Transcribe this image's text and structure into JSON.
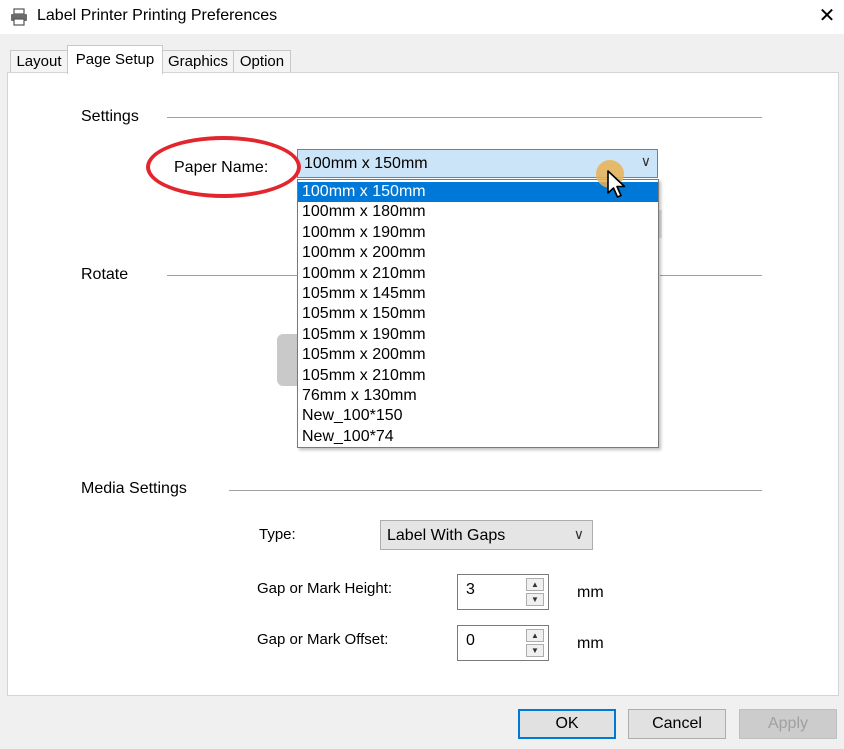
{
  "window": {
    "title": "Label Printer Printing Preferences",
    "close_glyph": "✕"
  },
  "tabs": [
    {
      "label": "Layout"
    },
    {
      "label": "Page Setup"
    },
    {
      "label": "Graphics"
    },
    {
      "label": "Option"
    }
  ],
  "settings": {
    "heading": "Settings",
    "paper_name_label": "Paper Name:",
    "paper_name_value": "100mm x 150mm",
    "paper_options": [
      "100mm x 150mm",
      "100mm x 180mm",
      "100mm x 190mm",
      "100mm x 200mm",
      "100mm x 210mm",
      "105mm x 145mm",
      "105mm x 150mm",
      "105mm x 190mm",
      "105mm x 200mm",
      "105mm x 210mm",
      "76mm x 130mm",
      "New_100*150",
      "New_100*74"
    ],
    "selected_index": 0
  },
  "rotate": {
    "heading": "Rotate"
  },
  "media": {
    "heading": "Media Settings",
    "type_label": "Type:",
    "type_value": "Label With Gaps",
    "gap_height_label": "Gap or Mark Height:",
    "gap_height_value": "3",
    "gap_offset_label": "Gap or Mark Offset:",
    "gap_offset_value": "0",
    "unit": "mm"
  },
  "buttons": {
    "ok": "OK",
    "cancel": "Cancel",
    "apply": "Apply"
  },
  "colors": {
    "accent": "#0078d7",
    "annotation": "#e3262e",
    "select_bg": "#cce4f7"
  },
  "icons": {
    "window": "printer-icon",
    "chevron": "chevron-down-icon",
    "cursor": "mouse-cursor-icon"
  }
}
